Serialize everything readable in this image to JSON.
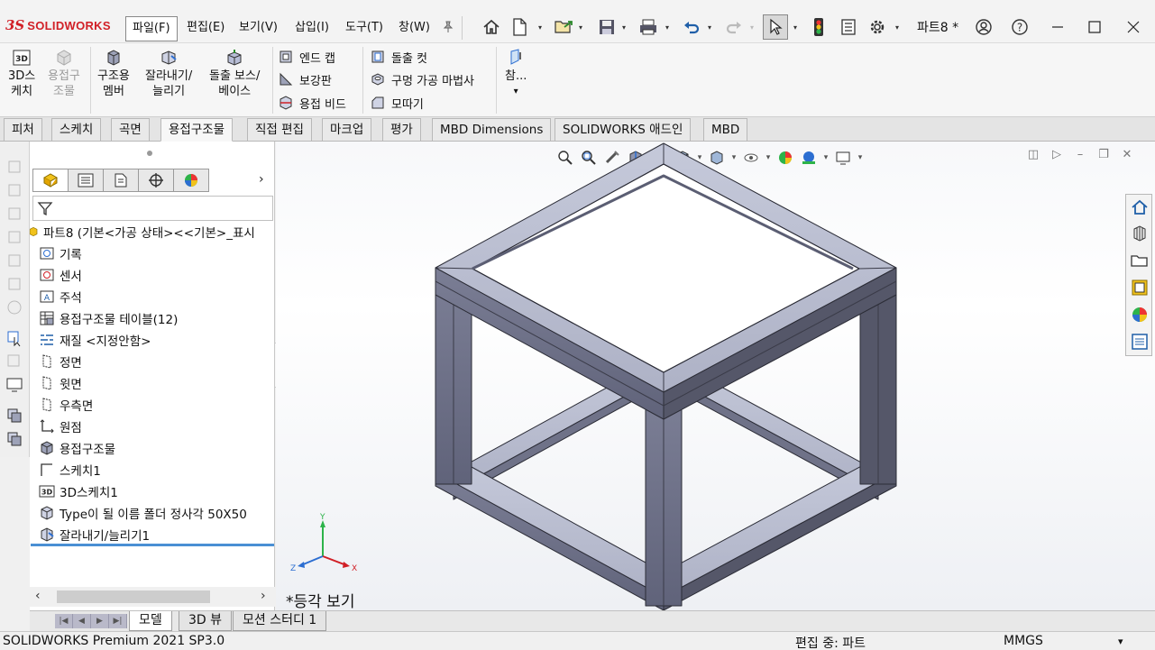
{
  "app": {
    "logo_mark": "3S",
    "logo_text": "SOLIDWORKS",
    "document_title": "파트8 *"
  },
  "menu": [
    {
      "label": "파일(F)",
      "active": true
    },
    {
      "label": "편집(E)"
    },
    {
      "label": "보기(V)"
    },
    {
      "label": "삽입(I)"
    },
    {
      "label": "도구(T)"
    },
    {
      "label": "창(W)"
    }
  ],
  "quick_access": [
    "home-icon",
    "new-document-icon",
    "open-icon",
    "save-icon",
    "print-icon",
    "undo-icon",
    "redo-icon",
    "select-icon",
    "rebuild-icon",
    "file-properties-icon",
    "options-icon"
  ],
  "ribbon": {
    "big_tools": [
      {
        "label_line1": "3D스",
        "label_line2": "케치",
        "icon": "3d-sketch-icon",
        "disabled": false
      },
      {
        "label_line1": "용접구",
        "label_line2": "조물",
        "icon": "weldment-icon",
        "disabled": true
      },
      {
        "label_line1": "구조용",
        "label_line2": "멤버",
        "icon": "structural-member-icon",
        "disabled": false
      },
      {
        "label_line1": "잘라내기/",
        "label_line2": "늘리기",
        "icon": "trim-extend-icon",
        "disabled": false
      },
      {
        "label_line1": "돌출 보스/",
        "label_line2": "베이스",
        "icon": "extruded-boss-icon",
        "disabled": false
      }
    ],
    "small_tools_col1": [
      "엔드 캡",
      "보강판",
      "용접 비드"
    ],
    "small_tools_col2": [
      "돌출 컷",
      "구멍 가공 마법사",
      "모따기"
    ],
    "reference_label": "참...",
    "reference_more": "▾"
  },
  "tabs": [
    {
      "label": "피처"
    },
    {
      "label": "스케치"
    },
    {
      "label": "곡면"
    },
    {
      "label": "용접구조물",
      "active": true
    },
    {
      "label": "직접 편집"
    },
    {
      "label": "마크업"
    },
    {
      "label": "평가"
    },
    {
      "label": "MBD Dimensions"
    },
    {
      "label": "SOLIDWORKS 애드인"
    },
    {
      "label": "MBD"
    }
  ],
  "feature_tree": {
    "root": "파트8  (기본<가공 상태><<기본>_표시",
    "items": [
      {
        "label": "기록",
        "icon": "history-icon"
      },
      {
        "label": "센서",
        "icon": "sensor-icon"
      },
      {
        "label": "주석",
        "icon": "annotation-icon"
      },
      {
        "label": "용접구조물 테이블(12)",
        "icon": "weldment-table-icon"
      },
      {
        "label": "재질 <지정안함>",
        "icon": "material-icon"
      },
      {
        "label": "정면",
        "icon": "plane-icon"
      },
      {
        "label": "윗면",
        "icon": "plane-icon"
      },
      {
        "label": "우측면",
        "icon": "plane-icon"
      },
      {
        "label": "원점",
        "icon": "origin-icon"
      },
      {
        "label": "용접구조물",
        "icon": "weldment-icon"
      },
      {
        "label": "스케치1",
        "icon": "sketch-icon"
      },
      {
        "label": "3D스케치1",
        "icon": "3d-sketch-icon"
      },
      {
        "label": "Type이 될 이름 폴더 정사각 50X50",
        "icon": "structural-member-icon"
      },
      {
        "label": "잘라내기/늘리기1",
        "icon": "trim-extend-icon"
      }
    ]
  },
  "viewport": {
    "view_name": "*등각 보기",
    "triad": {
      "x": "X",
      "y": "Y",
      "z": "Z"
    }
  },
  "bottom_tabs": [
    {
      "label": "모델",
      "active": true
    },
    {
      "label": "3D 뷰"
    },
    {
      "label": "모션 스터디 1"
    }
  ],
  "status": {
    "product": "SOLIDWORKS Premium 2021 SP3.0",
    "editing": "편집 중: 파트",
    "units": "MMGS",
    "units_caret": "▾"
  },
  "colors": {
    "brand_red": "#d11f26",
    "frame_top": "#bcc0d2",
    "frame_side": "#6f7288",
    "frame_dark": "#4a4c5e",
    "rollback_bar": "#4a8fd4"
  }
}
